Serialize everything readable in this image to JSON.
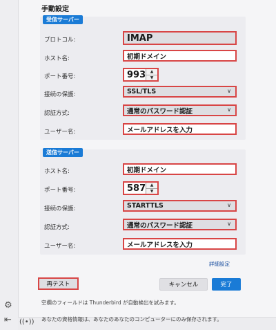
{
  "heading": "手動設定",
  "incoming": {
    "section_label": "受信サーバー",
    "protocol": {
      "label": "プロトコル:",
      "value": "IMAP"
    },
    "hostname": {
      "label": "ホスト名:",
      "value": "初期ドメイン"
    },
    "port": {
      "label": "ポート番号:",
      "value": "993"
    },
    "security": {
      "label": "接続の保護:",
      "value": "SSL/TLS"
    },
    "auth": {
      "label": "認証方式:",
      "value": "通常のパスワード認証"
    },
    "username": {
      "label": "ユーザー名:",
      "value": "メールアドレスを入力"
    }
  },
  "outgoing": {
    "section_label": "送信サーバー",
    "hostname": {
      "label": "ホスト名:",
      "value": "初期ドメイン"
    },
    "port": {
      "label": "ポート番号:",
      "value": "587"
    },
    "security": {
      "label": "接続の保護:",
      "value": "STARTTLS"
    },
    "auth": {
      "label": "認証方式:",
      "value": "通常のパスワード認証"
    },
    "username": {
      "label": "ユーザー名:",
      "value": "メールアドレスを入力"
    }
  },
  "advanced_link": "詳細設定",
  "buttons": {
    "retest": "再テスト",
    "cancel": "キャンセル",
    "done": "完了"
  },
  "notes": {
    "autodetect": "空欄のフィールドは Thunderbird が自動検出を試みます。",
    "partial": "あなたの資格情報は、あなたのあなたのコンピューターにのみ保存されます。"
  },
  "icons": {
    "settings": "gear-icon",
    "collapse": "collapse-sidebar-icon",
    "status": "online-status-icon",
    "dropdown": "chevron-down-icon",
    "spin_up": "spin-up-icon",
    "spin_down": "spin-down-icon"
  },
  "colors": {
    "accent": "#1a7bd6",
    "highlight_border": "#d84545"
  }
}
